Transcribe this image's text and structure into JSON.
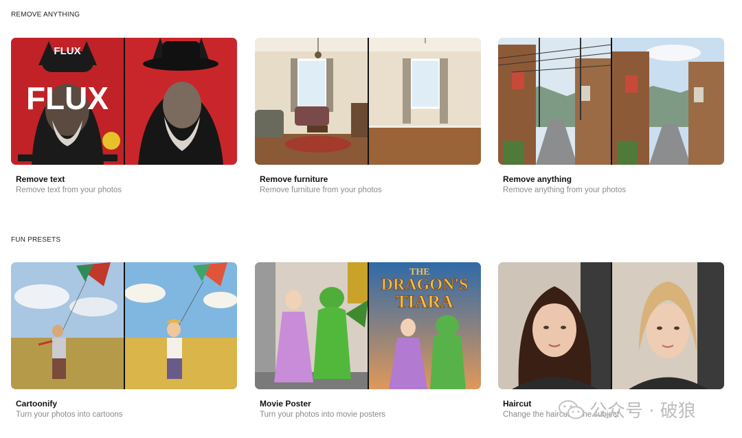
{
  "sections": [
    {
      "label": "REMOVE ANYTHING",
      "cards": [
        {
          "title": "Remove text",
          "subtitle": "Remove text from your photos",
          "poster_text": "FLUX"
        },
        {
          "title": "Remove furniture",
          "subtitle": "Remove furniture from your photos"
        },
        {
          "title": "Remove anything",
          "subtitle": "Remove anything from your photos"
        }
      ]
    },
    {
      "label": "FUN PRESETS",
      "cards": [
        {
          "title": "Cartoonify",
          "subtitle": "Turn your photos into cartoons"
        },
        {
          "title": "Movie Poster",
          "subtitle": "Turn your photos into movie posters",
          "poster_text_line1": "THE",
          "poster_text_line2": "DRAGON'S",
          "poster_text_line3": "TIARA"
        },
        {
          "title": "Haircut",
          "subtitle": "Change the haircut of the subject"
        }
      ]
    }
  ],
  "watermark": {
    "text": "公众号 · 破狼"
  }
}
